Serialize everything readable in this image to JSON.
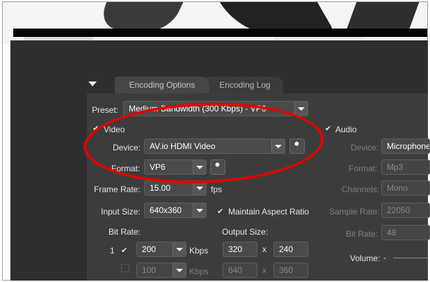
{
  "tabs": [
    {
      "label": "Encoding Options",
      "active": true
    },
    {
      "label": "Encoding Log",
      "active": false
    }
  ],
  "preset": {
    "label": "Preset:",
    "value": "Medium Bandwidth (300 Kbps) - VP6"
  },
  "video": {
    "checkbox_label": "Video",
    "device_label": "Device:",
    "device_value": "AV.io HDMI Video",
    "format_label": "Format:",
    "format_value": "VP6",
    "frame_rate_label": "Frame Rate:",
    "frame_rate_value": "15.00",
    "frame_rate_unit": "fps",
    "input_size_label": "Input Size:",
    "input_size_value": "640x360",
    "maintain_aspect_label": "Maintain Aspect Ratio",
    "bit_rate_label": "Bit Rate:",
    "output_size_label": "Output Size:",
    "row1": {
      "index": "1",
      "bitrate": "200",
      "unit": "Kbps",
      "width": "320",
      "x": "x",
      "height": "240"
    },
    "row2": {
      "bitrate": "100",
      "unit": "Kbps",
      "width": "640",
      "x": "x",
      "height": "360"
    }
  },
  "audio": {
    "checkbox_label": "Audio",
    "device_label": "Device:",
    "device_value": "Microphone",
    "format_label": "Format:",
    "format_value": "Mp3",
    "channels_label": "Channels:",
    "channels_value": "Mono",
    "sample_rate_label": "Sample Rate:",
    "sample_rate_value": "22050",
    "bit_rate_label": "Bit Rate:",
    "bit_rate_value": "48",
    "volume_label": "Volume:",
    "volume_min": "-"
  },
  "colors": {
    "highlight_ring": "#e50000",
    "panel_bg": "#3c3c3c",
    "app_bg": "#2f2f2f"
  }
}
